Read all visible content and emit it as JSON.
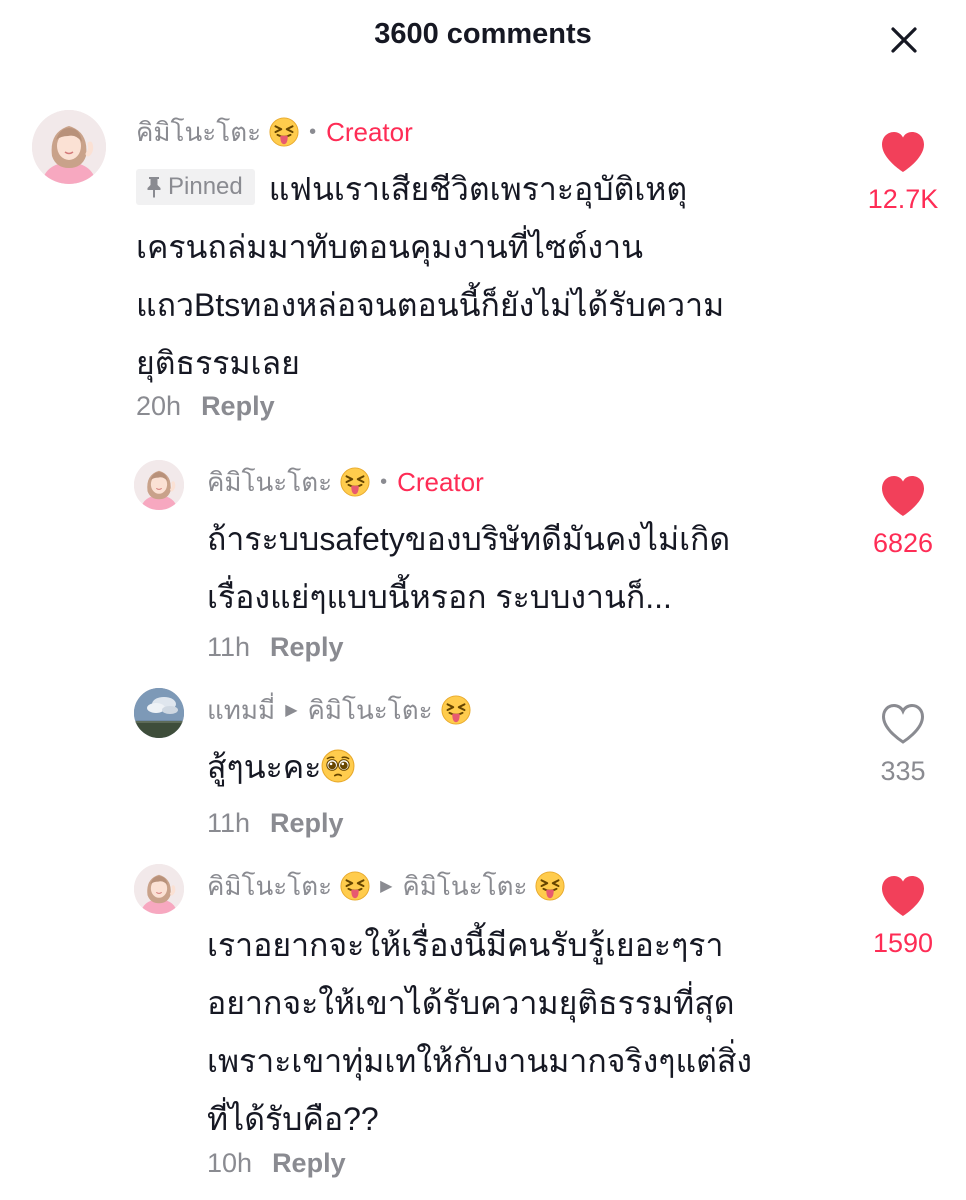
{
  "header": {
    "title": "3600 comments",
    "close_icon": "close-icon"
  },
  "colors": {
    "accent": "#fe2c55",
    "muted": "#8a8b91",
    "text": "#161823"
  },
  "comments": [
    {
      "username": "คิมิโนะโตะ",
      "badge": "Creator",
      "pinned_label": "Pinned",
      "text_lines": [
        "แฟนเราเสียชีวิตเพราะอุบัติเหตุ",
        "เครนถล่มมาทับตอนคุมงานที่ไซต์งาน",
        "แถวBtsทองหล่อจนตอนนี้ก็ยังไม่ได้รับความ",
        "ยุติธรรมเลย"
      ],
      "time": "20h",
      "reply_label": "Reply",
      "likes": "12.7K",
      "liked": true
    }
  ],
  "replies": [
    {
      "username": "คิมิโนะโตะ",
      "badge": "Creator",
      "text_lines": [
        "ถ้าระบบsafetyของบริษัทดีมันคงไม่เกิด",
        "เรื่องแย่ๆแบบนี้หรอก ระบบงานก็..."
      ],
      "time": "11h",
      "reply_label": "Reply",
      "likes": "6826",
      "liked": true
    },
    {
      "username": "แทมมี่",
      "reply_to": "คิมิโนะโตะ",
      "text": "สู้ๆนะคะ",
      "time": "11h",
      "reply_label": "Reply",
      "likes": "335",
      "liked": false
    },
    {
      "username": "คิมิโนะโตะ",
      "reply_to": "คิมิโนะโตะ",
      "text_lines": [
        "เราอยากจะให้เรื่องนี้มีคนรับรู้เยอะๆรา",
        "อยากจะให้เขาได้รับความยุติธรรมที่สุด",
        "เพราะเขาทุ่มเทให้กับงานมากจริงๆแต่สิ่ง",
        "ที่ได้รับคือ??"
      ],
      "time": "10h",
      "reply_label": "Reply",
      "likes": "1590",
      "liked": true
    }
  ]
}
